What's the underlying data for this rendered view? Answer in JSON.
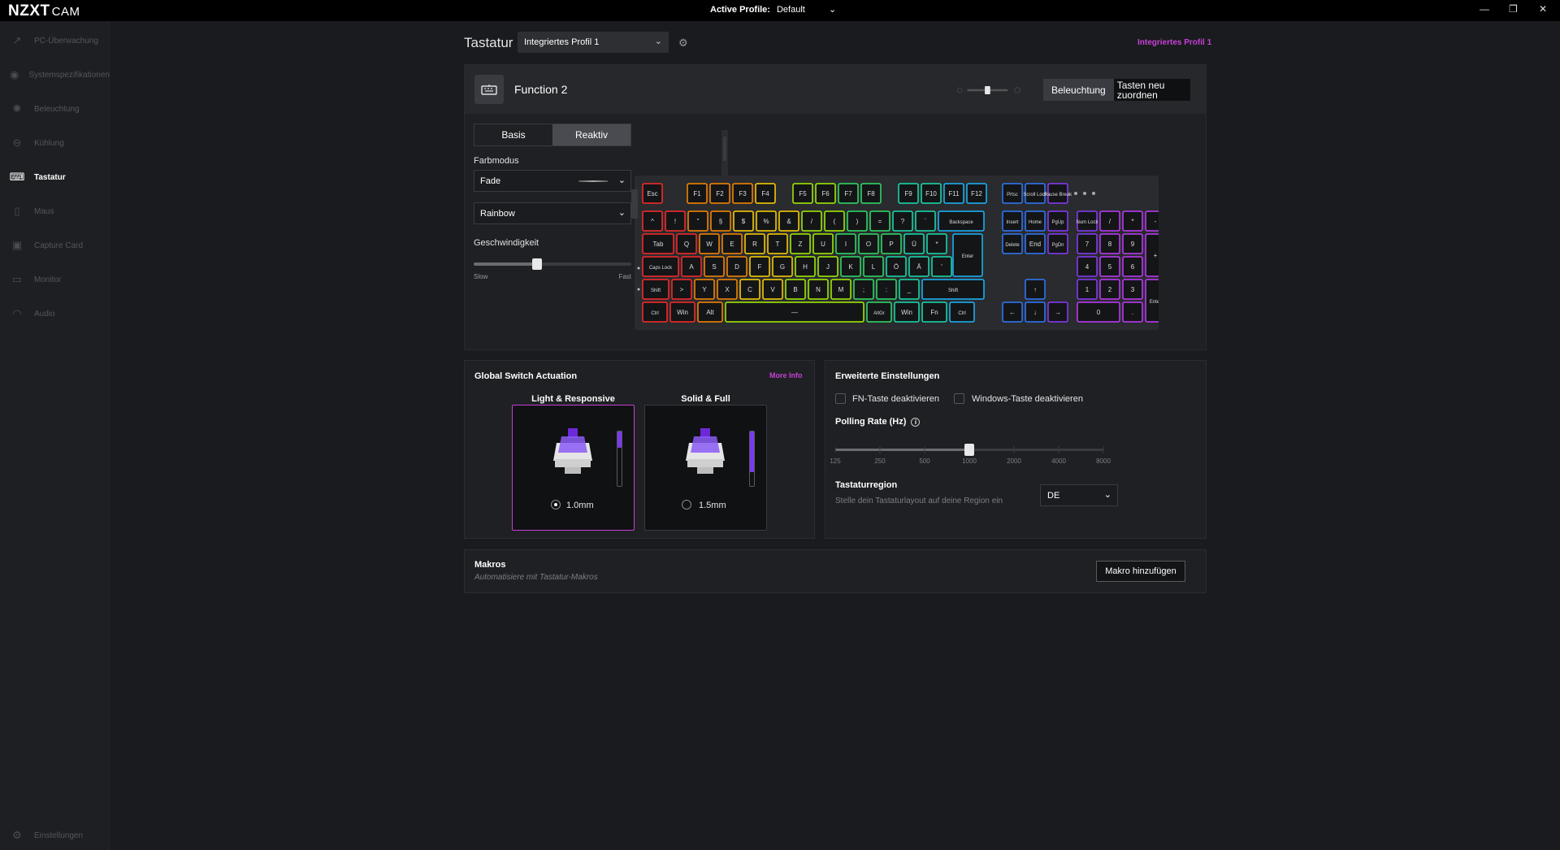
{
  "app": {
    "brand": "NZXT",
    "brand_suffix": "CAM",
    "active_profile_label": "Active Profile:",
    "active_profile_value": "Default"
  },
  "sidebar": {
    "items": [
      {
        "label": "PC-Überwachung",
        "icon": "chart-line-icon"
      },
      {
        "label": "Systemspezifikationen",
        "icon": "eye-icon"
      },
      {
        "label": "Beleuchtung",
        "icon": "sun-icon"
      },
      {
        "label": "Kühlung",
        "icon": "cooler-icon"
      },
      {
        "label": "Tastatur",
        "icon": "keyboard-icon",
        "active": true
      },
      {
        "label": "Maus",
        "icon": "mouse-icon"
      },
      {
        "label": "Capture Card",
        "icon": "capture-card-icon"
      },
      {
        "label": "Monitor",
        "icon": "monitor-icon"
      },
      {
        "label": "Audio",
        "icon": "headset-icon"
      }
    ],
    "settings_label": "Einstellungen"
  },
  "header": {
    "title": "Tastatur",
    "profile": "Integriertes Profil 1",
    "profile_link": "Integriertes Profil 1"
  },
  "device": {
    "name": "Function 2",
    "btn_lighting": "Beleuchtung",
    "btn_remap": "Tasten neu zuordnen",
    "brightness_fraction": 0.5
  },
  "lighting": {
    "tabs": [
      "Basis",
      "Reaktiv"
    ],
    "selected_tab": "Reaktiv",
    "color_mode_label": "Farbmodus",
    "color_mode": "Fade",
    "palette": "Rainbow",
    "speed_label": "Geschwindigkeit",
    "speed_min": "Slow",
    "speed_max": "Fast",
    "speed_fraction": 0.4,
    "nzxt_logo": "NZXT"
  },
  "keyboard": {
    "fn_row": [
      "Esc",
      "F1",
      "F2",
      "F3",
      "F4",
      "F5",
      "F6",
      "F7",
      "F8",
      "F9",
      "F10",
      "F11",
      "F12",
      "Prtsc",
      "Scroll Lock",
      "Pause Break"
    ],
    "row1": [
      "^",
      "!",
      "\"",
      "§",
      "$",
      "%",
      "&",
      "/",
      "(",
      ")",
      "=",
      "?",
      "`",
      "Backspace"
    ],
    "row2": [
      "Tab",
      "Q",
      "W",
      "E",
      "R",
      "T",
      "Z",
      "U",
      "I",
      "O",
      "P",
      "Ü",
      "*",
      "Enter"
    ],
    "row3": [
      "Caps Lock",
      "A",
      "S",
      "D",
      "F",
      "G",
      "H",
      "J",
      "K",
      "L",
      "Ö",
      "Ä",
      "'"
    ],
    "row4": [
      "Shift",
      ">",
      "Y",
      "X",
      "C",
      "V",
      "B",
      "N",
      "M",
      ";",
      ":",
      "_",
      "Shift"
    ],
    "row5": [
      "Ctrl",
      "Win",
      "Alt",
      "—",
      "AltGr",
      "Win",
      "Fn",
      "Ctrl"
    ],
    "nav": [
      "Insert",
      "Home",
      "PgUp",
      "Delete",
      "End",
      "PgDn"
    ],
    "arrows": [
      "↑",
      "←",
      "↓",
      "→"
    ],
    "numpad": [
      "Num Lock",
      "/",
      "*",
      "-",
      "7",
      "8",
      "9",
      "+",
      "4",
      "5",
      "6",
      "1",
      "2",
      "3",
      "Enter",
      "0",
      "."
    ]
  },
  "actuation": {
    "title": "Global Switch Actuation",
    "more_info": "More Info",
    "options": [
      {
        "label": "Light & Responsive",
        "value": "1.0mm",
        "selected": true,
        "level": 0.3
      },
      {
        "label": "Solid & Full",
        "value": "1.5mm",
        "selected": false,
        "level": 0.75
      }
    ]
  },
  "advanced": {
    "title": "Erweiterte Einstellungen",
    "fn_disable": "FN-Taste deaktivieren",
    "win_disable": "Windows-Taste deaktivieren",
    "polling_label": "Polling Rate (Hz)",
    "polling_ticks": [
      "125",
      "250",
      "500",
      "1000",
      "2000",
      "4000",
      "8000"
    ],
    "polling_value": "1000",
    "region_label": "Tastaturregion",
    "region_sub": "Stelle dein Tastaturlayout auf deine Region ein",
    "region_value": "DE"
  },
  "macros": {
    "title": "Makros",
    "subtitle": "Automatisiere mit Tastatur-Makros",
    "add_button": "Makro hinzufügen"
  },
  "colors": {
    "accent": "#c640d6",
    "switch_purple": "#7c3aed"
  }
}
